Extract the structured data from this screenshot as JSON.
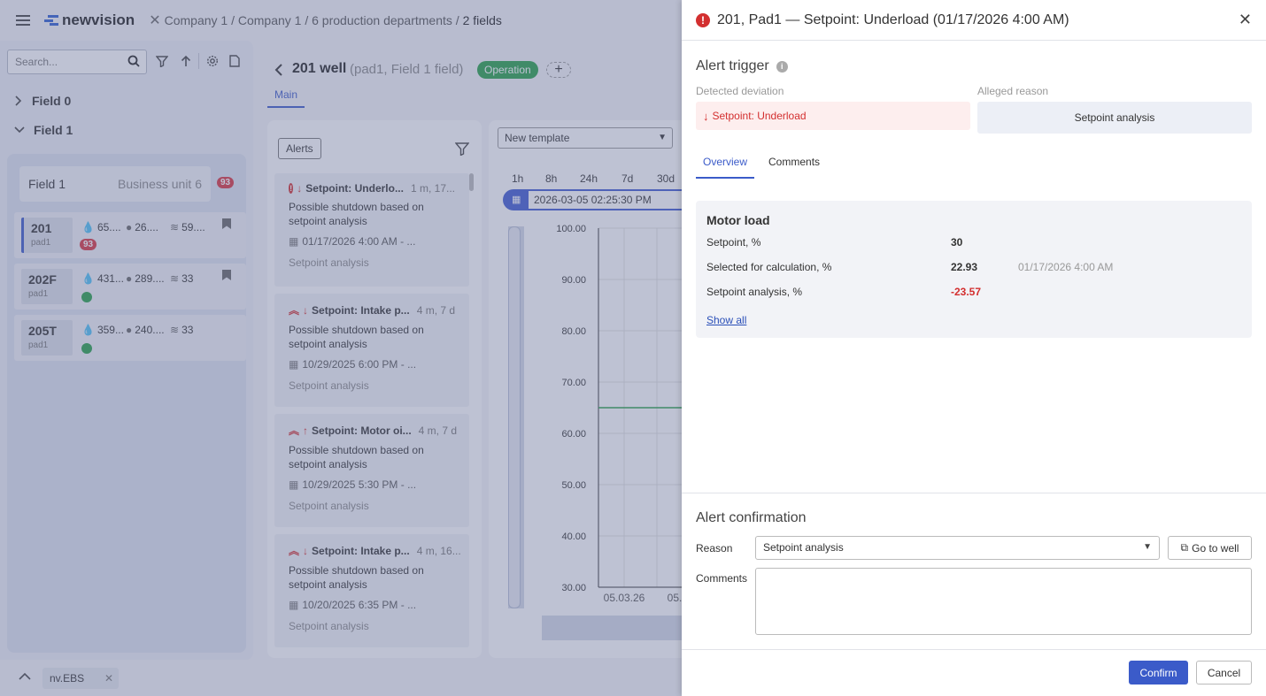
{
  "app": {
    "logo": "newvision"
  },
  "breadcrumb": [
    "Company 1",
    "Company 1",
    "6 production departments",
    "2 fields"
  ],
  "sidebar": {
    "search_placeholder": "Search...",
    "tree": [
      {
        "label": "Field 0"
      },
      {
        "label": "Field 1"
      }
    ],
    "field_card": {
      "name": "Field 1",
      "unit": "Business unit 6",
      "badge": "93"
    },
    "wells": [
      {
        "name": "201",
        "pad": "pad1",
        "m1": "65....",
        "m2": "26....",
        "m3": "59....",
        "badge": "93",
        "status": "badge"
      },
      {
        "name": "202F",
        "pad": "pad1",
        "m1": "431...",
        "m2": "289....",
        "m3": "33",
        "status": "dot"
      },
      {
        "name": "205T",
        "pad": "pad1",
        "m1": "359...",
        "m2": "240....",
        "m3": "33",
        "status": "dot"
      }
    ]
  },
  "bottom_tab": {
    "label": "nv.EBS"
  },
  "well_header": {
    "title": "201 well",
    "subtitle": "(pad1, Field 1 field)",
    "status": "Operation",
    "tab_main": "Main"
  },
  "alerts": {
    "button": "Alerts",
    "items": [
      {
        "title": "Setpoint: Underlo...",
        "time": "1 m, 17...",
        "desc": "Possible shutdown based on setpoint analysis",
        "date": "01/17/2026 4:00 AM - ...",
        "reason": "Setpoint analysis",
        "level": "critical",
        "dir": "down"
      },
      {
        "title": "Setpoint: Intake p...",
        "time": "4 m, 7 d",
        "desc": "Possible shutdown based on setpoint analysis",
        "date": "10/29/2025 6:00 PM - ...",
        "reason": "Setpoint analysis",
        "level": "high",
        "dir": "down"
      },
      {
        "title": "Setpoint: Motor oi...",
        "time": "4 m, 7 d",
        "desc": "Possible shutdown based on setpoint analysis",
        "date": "10/29/2025 5:30 PM - ...",
        "reason": "Setpoint analysis",
        "level": "high",
        "dir": "up"
      },
      {
        "title": "Setpoint: Intake p...",
        "time": "4 m, 16...",
        "desc": "Possible shutdown based on setpoint analysis",
        "date": "10/20/2025 6:35 PM - ...",
        "reason": "Setpoint analysis",
        "level": "high",
        "dir": "down"
      }
    ]
  },
  "chart": {
    "template": "New template",
    "ranges": [
      "1h",
      "8h",
      "24h",
      "7d",
      "30d"
    ],
    "date": "2026-03-05 02:25:30 PM",
    "yticks": [
      "100.00",
      "90.00",
      "80.00",
      "70.00",
      "60.00",
      "50.00",
      "40.00",
      "30.00"
    ],
    "xticks": [
      "05.03.26",
      "05."
    ],
    "line_value": 65
  },
  "drawer": {
    "title": "201, Pad1 — Setpoint: Underload (01/17/2026 4:00 AM)",
    "trigger_title": "Alert trigger",
    "detected_label": "Detected deviation",
    "detected_value": "Setpoint: Underload",
    "alleged_label": "Alleged reason",
    "alleged_value": "Setpoint analysis",
    "tabs": [
      "Overview",
      "Comments"
    ],
    "motor": {
      "title": "Motor load",
      "rows": [
        {
          "label": "Setpoint, %",
          "value": "30",
          "extra": ""
        },
        {
          "label": "Selected for calculation, %",
          "value": "22.93",
          "extra": "01/17/2026 4:00 AM"
        },
        {
          "label": "Setpoint analysis, %",
          "value": "-23.57",
          "extra": ""
        }
      ],
      "show_all": "Show all"
    },
    "confirmation": {
      "title": "Alert confirmation",
      "reason_label": "Reason",
      "reason_value": "Setpoint analysis",
      "goto": "Go to well",
      "comments_label": "Comments",
      "comments_value": ""
    },
    "confirm": "Confirm",
    "cancel": "Cancel"
  },
  "colors": {
    "accent": "#3b5bc9",
    "danger": "#d32f2f",
    "green": "#27a048"
  }
}
